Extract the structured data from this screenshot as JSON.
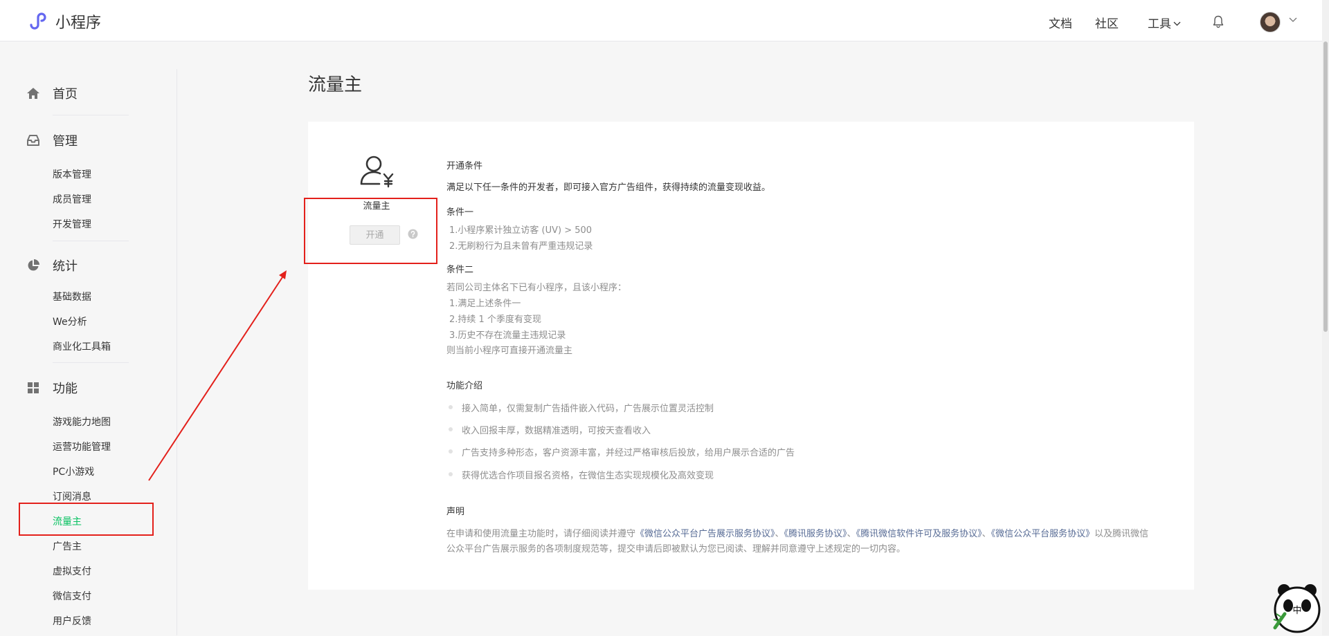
{
  "header": {
    "brand": "小程序",
    "nav": {
      "docs": "文档",
      "community": "社区",
      "tools": "工具"
    }
  },
  "sidebar": {
    "home": "首页",
    "manage": {
      "title": "管理",
      "items": [
        "版本管理",
        "成员管理",
        "开发管理"
      ]
    },
    "stats": {
      "title": "统计",
      "items": [
        "基础数据",
        "We分析",
        "商业化工具箱"
      ]
    },
    "features": {
      "title": "功能",
      "items": [
        "游戏能力地图",
        "运营功能管理",
        "PC小游戏",
        "订阅消息",
        "流量主",
        "广告主",
        "虚拟支付",
        "微信支付",
        "用户反馈"
      ],
      "active": "流量主"
    }
  },
  "main": {
    "title": "流量主",
    "feature_name": "流量主",
    "open_button": "开通",
    "conditions_heading": "开通条件",
    "conditions_intro": "满足以下任一条件的开发者，即可接入官方广告组件，获得持续的流量变现收益。",
    "cond1_heading": "条件一",
    "cond1_items": [
      "1.小程序累计独立访客 (UV) > 500",
      "2.无刷粉行为且未曾有严重违规记录"
    ],
    "cond2_heading": "条件二",
    "cond2_intro": "若同公司主体名下已有小程序，且该小程序：",
    "cond2_items": [
      "1.满足上述条件一",
      "2.持续 1 个季度有变现",
      "3.历史不存在流量主违规记录"
    ],
    "cond2_outro": "则当前小程序可直接开通流量主",
    "intro_heading": "功能介绍",
    "intro_items": [
      "接入简单，仅需复制广告插件嵌入代码，广告展示位置灵活控制",
      "收入回报丰厚，数据精准透明，可按天查看收入",
      "广告支持多种形态，客户资源丰富，并经过严格审核后投放，给用户展示合适的广告",
      "获得优选合作项目报名资格，在微信生态实现规模化及高效变现"
    ],
    "statement_heading": "声明",
    "statement": {
      "prefix": "在申请和使用流量主功能时，请仔细阅读并遵守",
      "link1": "《微信公众平台广告展示服务协议》",
      "sep1": "、",
      "link2": "《腾讯服务协议》",
      "sep2": "、",
      "link3": "《腾讯微信软件许可及服务协议》",
      "sep3": "、",
      "link4": "《微信公众平台服务协议》",
      "suffix": "以及腾讯微信公众平台广告展示服务的各项制度规范等，提交申请后即被默认为您已阅读、理解并同意遵守上述规定的一切内容。"
    }
  },
  "mascot_text": "中",
  "colors": {
    "active_green": "#07c160",
    "link_blue": "#576b95",
    "annotation_red": "#e3201b",
    "brand_purple": "#6467f0"
  }
}
